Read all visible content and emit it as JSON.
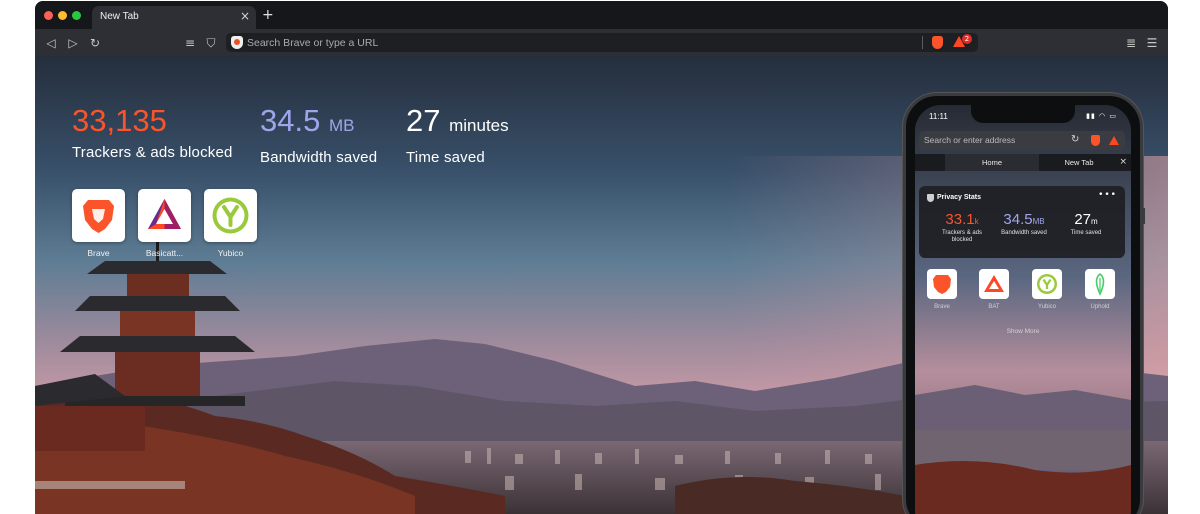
{
  "window": {
    "tab_title": "New Tab",
    "tab_close": "×",
    "new_tab": "+"
  },
  "toolbar": {
    "back": "◁",
    "forward": "▷",
    "reload": "↻",
    "reader": "≡",
    "bookmark": "⛉",
    "url_placeholder": "Search Brave or type a URL",
    "rewards_badge": "2",
    "playlist": "≣",
    "menu": "☰"
  },
  "stats": {
    "trackers_value": "33,135",
    "trackers_label": "Trackers & ads blocked",
    "bandwidth_value": "34.5",
    "bandwidth_unit": "MB",
    "bandwidth_label": "Bandwidth saved",
    "time_value": "27",
    "time_unit": "minutes",
    "time_label": "Time saved",
    "colors": {
      "trackers": "#fb542b",
      "bandwidth": "#a0a5eb",
      "time": "#ffffff"
    }
  },
  "tiles": [
    {
      "label": "Brave",
      "icon": "brave-lion-icon"
    },
    {
      "label": "Basicatt...",
      "icon": "bat-triangle-icon"
    },
    {
      "label": "Yubico",
      "icon": "yubico-icon"
    }
  ],
  "phone": {
    "time": "11:11",
    "address_placeholder": "Search or enter address",
    "tab_home": "Home",
    "tab_new": "New Tab",
    "tab_close": "×",
    "card_title": "Privacy Stats",
    "card_more": "•••",
    "stat1_value": "33.1",
    "stat1_unit": "k",
    "stat1_label": "Trackers & ads blocked",
    "stat2_value": "34.5",
    "stat2_unit": "MB",
    "stat2_label": "Bandwidth saved",
    "stat3_value": "27",
    "stat3_unit": "m",
    "stat3_label": "Time saved",
    "tiles": [
      {
        "label": "Brave",
        "icon": "brave-lion-icon"
      },
      {
        "label": "BAT",
        "icon": "bat-triangle-icon"
      },
      {
        "label": "Yubico",
        "icon": "yubico-icon"
      },
      {
        "label": "Uphold",
        "icon": "uphold-icon"
      }
    ],
    "show_more": "Show More"
  }
}
